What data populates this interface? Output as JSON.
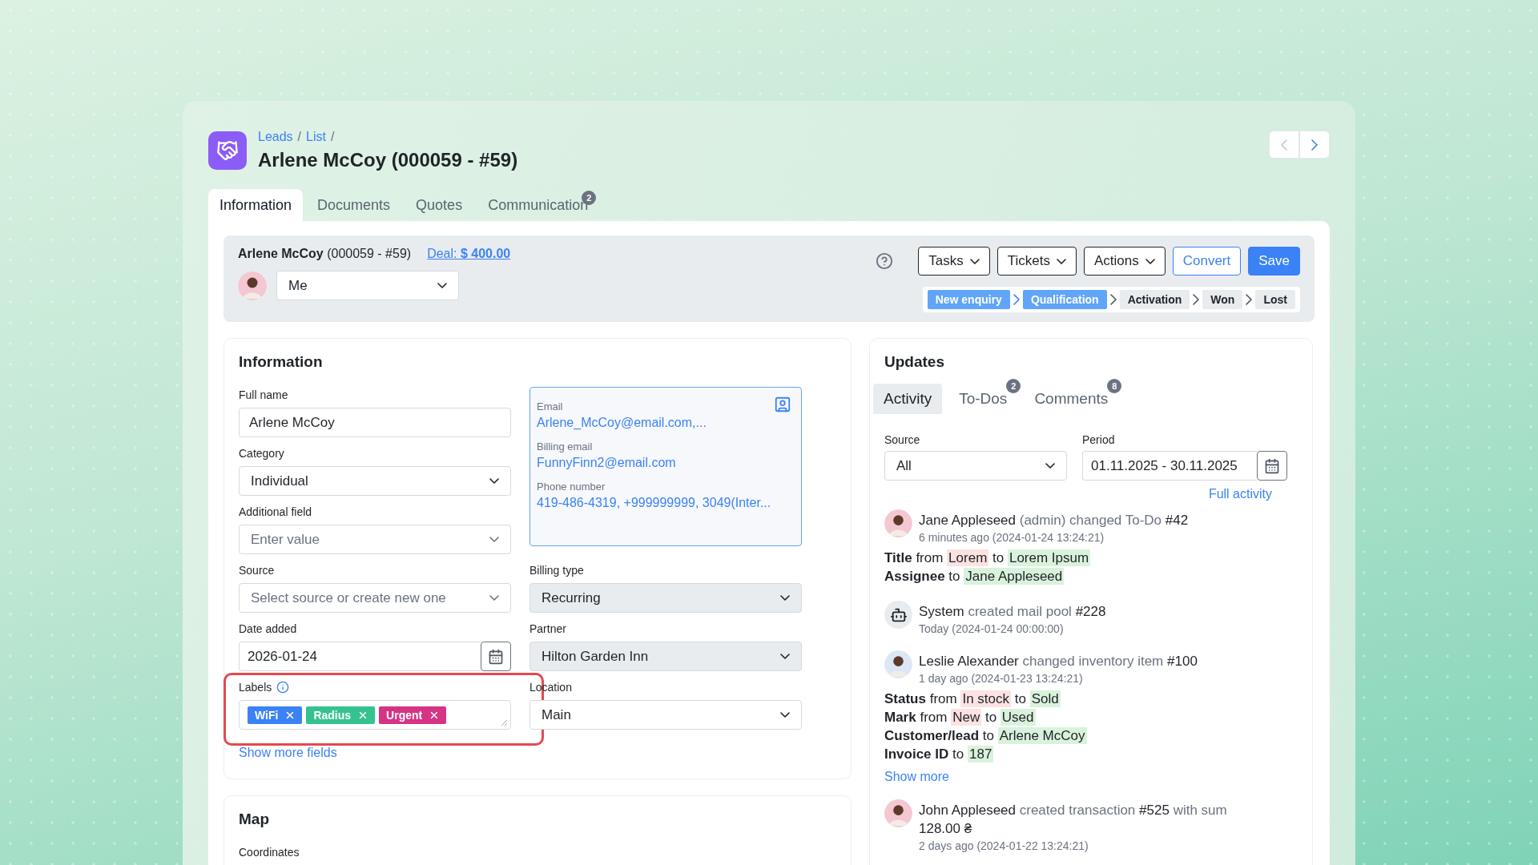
{
  "header": {
    "breadcrumb": [
      {
        "label": "Leads"
      },
      {
        "label": "List"
      }
    ],
    "separator": "/",
    "title": "Arlene McCoy (000059 - #59)"
  },
  "tabs": [
    {
      "label": "Information",
      "selected": true
    },
    {
      "label": "Documents",
      "selected": false
    },
    {
      "label": "Quotes",
      "selected": false
    },
    {
      "label": "Communication",
      "selected": false,
      "badge": "2"
    }
  ],
  "summary": {
    "name": "Arlene McCoy",
    "code": "(000059 - #59)",
    "deal": "Deal: **$ 400.00**",
    "owner": "Me",
    "buttons": [
      {
        "label": "Tasks",
        "kind": "menu"
      },
      {
        "label": "Tickets",
        "kind": "menu"
      },
      {
        "label": "Actions",
        "kind": "menu"
      },
      {
        "label": "Convert",
        "kind": "secondary"
      },
      {
        "label": "Save",
        "kind": "primary"
      }
    ],
    "pipeline": [
      {
        "label": "New enquiry",
        "selected": true
      },
      {
        "label": "Qualification",
        "selected": true
      },
      {
        "label": "Activation",
        "selected": false
      },
      {
        "label": "Won",
        "selected": false
      },
      {
        "label": "Lost",
        "selected": false
      }
    ]
  },
  "info": {
    "title": "Information",
    "left_fields": [
      {
        "label": "Full name",
        "kind": "text",
        "value": "Arlene McCoy"
      },
      {
        "label": "Category",
        "kind": "select",
        "value": "Individual"
      },
      {
        "label": "Additional field",
        "kind": "select",
        "placeholder": "Enter value"
      },
      {
        "label": "Source",
        "kind": "select",
        "placeholder": "Select source or create new one"
      },
      {
        "label": "Date added",
        "kind": "date",
        "value": "2026-01-24"
      },
      {
        "label": "Labels",
        "kind": "tags",
        "highlighted": true,
        "tags": [
          {
            "label": "WiFi",
            "color": "#3b82f6"
          },
          {
            "label": "Radius",
            "color": "#34c38f"
          },
          {
            "label": "Urgent",
            "color": "#d63384"
          }
        ]
      }
    ],
    "contact": [
      {
        "label": "Email",
        "value": "Arlene_McCoy@email.com,..."
      },
      {
        "label": "Billing email",
        "value": "FunnyFinn2@email.com"
      },
      {
        "label": "Phone number",
        "value": "419-486-4319, +999999999, 3049(Inter..."
      }
    ],
    "right_fields": [
      {
        "label": "Billing type",
        "kind": "select",
        "value": "Recurring",
        "readonly": true
      },
      {
        "label": "Partner",
        "kind": "select",
        "value": "Hilton Garden Inn",
        "readonly": true
      },
      {
        "label": "Location",
        "kind": "select",
        "value": "Main",
        "readonly": false
      }
    ],
    "show_more": "Show more fields"
  },
  "map": {
    "title": "Map",
    "field_label": "Coordinates"
  },
  "updates": {
    "title": "Updates",
    "tabs": [
      {
        "label": "Activity",
        "selected": true
      },
      {
        "label": "To-Dos",
        "selected": false,
        "badge": "2"
      },
      {
        "label": "Comments",
        "selected": false,
        "badge": "8"
      }
    ],
    "source": {
      "label": "Source",
      "value": "All"
    },
    "period": {
      "label": "Period",
      "value": "01.11.2025 - 30.11.2025"
    },
    "full_activity": "Full activity",
    "entries": [
      {
        "kind": "person",
        "headline": [
          {
            "text": "Jane Appleseed",
            "kind": "dark"
          },
          {
            "text": "(admin) changed To-Do",
            "kind": "muted"
          },
          {
            "text": "#42",
            "kind": "dark"
          }
        ],
        "time": "6 minutes ago (2024-01-24 13:24:21)",
        "changes": [
          [
            {
              "text": "Title",
              "kind": "field"
            },
            {
              "text": "from",
              "kind": "plain"
            },
            {
              "text": "Lorem",
              "kind": "old"
            },
            {
              "text": "to",
              "kind": "plain"
            },
            {
              "text": "Lorem Ipsum",
              "kind": "new"
            }
          ],
          [
            {
              "text": "Assignee",
              "kind": "field"
            },
            {
              "text": "to",
              "kind": "plain"
            },
            {
              "text": "Jane Appleseed",
              "kind": "new"
            }
          ]
        ]
      },
      {
        "kind": "system",
        "headline": [
          {
            "text": "System",
            "kind": "dark"
          },
          {
            "text": "created mail pool",
            "kind": "muted"
          },
          {
            "text": "#228",
            "kind": "dark"
          }
        ],
        "time": "Today (2024-01-24 00:00:00)"
      },
      {
        "kind": "person",
        "headline": [
          {
            "text": "Leslie Alexander",
            "kind": "dark"
          },
          {
            "text": "changed inventory item",
            "kind": "muted"
          },
          {
            "text": "#100",
            "kind": "dark"
          }
        ],
        "time": "1 day ago (2024-01-23 13:24:21)",
        "changes": [
          [
            {
              "text": "Status",
              "kind": "field"
            },
            {
              "text": "from",
              "kind": "plain"
            },
            {
              "text": "In stock",
              "kind": "old"
            },
            {
              "text": "to",
              "kind": "plain"
            },
            {
              "text": "Sold",
              "kind": "new"
            }
          ],
          [
            {
              "text": "Mark",
              "kind": "field"
            },
            {
              "text": "from",
              "kind": "plain"
            },
            {
              "text": "New",
              "kind": "old"
            },
            {
              "text": "to",
              "kind": "plain"
            },
            {
              "text": "Used",
              "kind": "new"
            }
          ],
          [
            {
              "text": "Customer/lead",
              "kind": "field"
            },
            {
              "text": "to",
              "kind": "plain"
            },
            {
              "text": "Arlene McCoy",
              "kind": "new"
            }
          ],
          [
            {
              "text": "Invoice ID",
              "kind": "field"
            },
            {
              "text": "to",
              "kind": "plain"
            },
            {
              "text": "187",
              "kind": "new"
            }
          ]
        ],
        "show_more": "Show more"
      },
      {
        "kind": "person",
        "headline": [
          {
            "text": "John Appleseed",
            "kind": "dark"
          },
          {
            "text": "created transaction",
            "kind": "muted"
          },
          {
            "text": "#525",
            "kind": "dark"
          },
          {
            "text": "with sum",
            "kind": "muted"
          },
          {
            "text": "128.00 ₴",
            "kind": "dark"
          }
        ],
        "time": "2 days ago (2024-01-22 13:24:21)"
      }
    ]
  }
}
